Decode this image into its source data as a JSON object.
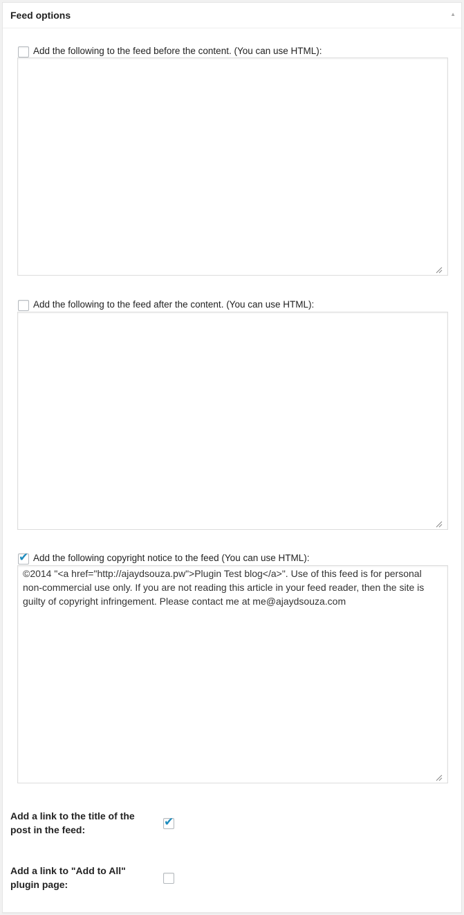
{
  "postbox": {
    "title": "Feed options",
    "toggle_icon": "triangle-up-icon"
  },
  "fields": [
    {
      "label": "Add the following to the feed before the content. (You can use HTML):",
      "checked": false,
      "value": ""
    },
    {
      "label": "Add the following to the feed after the content. (You can use HTML):",
      "checked": false,
      "value": ""
    },
    {
      "label": "Add the following copyright notice to the feed (You can use HTML):",
      "checked": true,
      "value": "©2014 \"<a href=\"http://ajaydsouza.pw\">Plugin Test blog</a>\". Use of this feed is for personal non-commercial use only. If you are not reading this article in your feed reader, then the site is guilty of copyright infringement. Please contact me at me@ajaydsouza.com"
    }
  ],
  "settings": [
    {
      "label": "Add a link to the title of the post in the feed:",
      "checked": true
    },
    {
      "label": "Add a link to \"Add to All\" plugin page:",
      "checked": false
    }
  ],
  "colors": {
    "accent": "#1e8cbe",
    "border": "#dddddd"
  }
}
